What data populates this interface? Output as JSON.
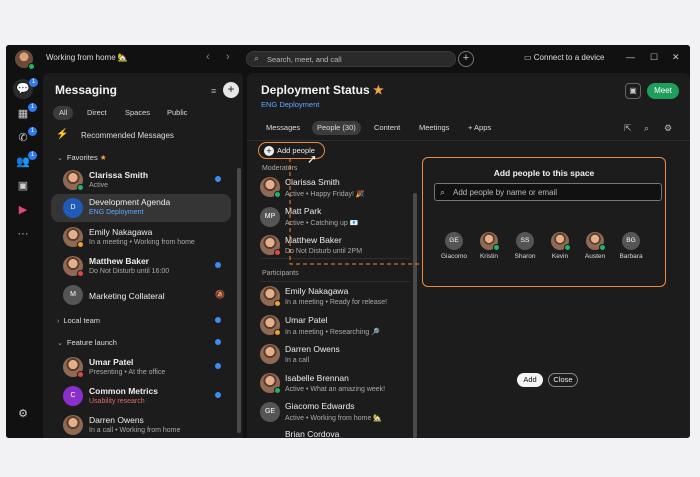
{
  "titlebar": {
    "status": "Working from home 🏡",
    "search_placeholder": "Search, meet, and call",
    "connect_label": "Connect to a device",
    "nav_back": "‹",
    "nav_forward": "›",
    "plus": "+",
    "minimize": "—",
    "maximize": "☐",
    "close": "✕"
  },
  "rail": {
    "icons": [
      "messaging-icon",
      "calendar-icon",
      "calls-icon",
      "teams-icon",
      "contacts-icon",
      "apps-icon",
      "more-icon",
      "settings-icon"
    ],
    "badges": [
      "1",
      "1",
      "1",
      "1"
    ]
  },
  "sidebar": {
    "title": "Messaging",
    "tabs": [
      "All",
      "Direct",
      "Spaces",
      "Public"
    ],
    "recommended": "Recommended Messages",
    "favorites_label": "Favorites",
    "local_team_label": "Local team",
    "feature_launch_label": "Feature launch",
    "items": [
      {
        "name": "Clarissa Smith",
        "status": "Active",
        "initials": "",
        "bold": true
      },
      {
        "name": "Development Agenda",
        "status": "ENG Deployment",
        "initials": "D",
        "bold": false
      },
      {
        "name": "Emily Nakagawa",
        "status": "In a meeting  •  Working from home",
        "initials": "",
        "bold": false
      },
      {
        "name": "Matthew Baker",
        "status": "Do Not Disturb until 16:00",
        "initials": "",
        "bold": true
      },
      {
        "name": "Marketing Collateral",
        "status": "",
        "initials": "M",
        "bold": false
      },
      {
        "name": "Umar Patel",
        "status": "Presenting  •  At the office",
        "initials": "",
        "bold": true
      },
      {
        "name": "Common Metrics",
        "status": "Usability research",
        "initials": "C",
        "bold": true
      },
      {
        "name": "Darren Owens",
        "status": "In a call  •  Working from home",
        "initials": "",
        "bold": false
      }
    ]
  },
  "space": {
    "title": "Deployment Status",
    "subtitle": "ENG Deployment",
    "meet": "Meet",
    "tabs": [
      "Messages",
      "People (30)",
      "Content",
      "Meetings",
      "+ Apps"
    ],
    "add_people": "Add people",
    "moderators_label": "Moderators",
    "participants_label": "Participants",
    "moderators": [
      {
        "name": "Clarissa Smith",
        "status": "Active  •  Happy Friday! 🎉",
        "initials": ""
      },
      {
        "name": "Matt Park",
        "status": "Active  •  Catching up 📧",
        "initials": "MP"
      },
      {
        "name": "Matthew Baker",
        "status": "Do Not Disturb until 2PM",
        "initials": ""
      }
    ],
    "participants": [
      {
        "name": "Emily Nakagawa",
        "status": "In a meeting  •  Ready for release!",
        "initials": ""
      },
      {
        "name": "Umar Patel",
        "status": "In a meeting  •  Researching 🔎",
        "initials": ""
      },
      {
        "name": "Darren Owens",
        "status": "In a call",
        "initials": ""
      },
      {
        "name": "Isabelle Brennan",
        "status": "Active  •  What an amazing week!",
        "initials": ""
      },
      {
        "name": "Giacomo Edwards",
        "status": "Active  •  Working from home 🏡",
        "initials": "GE"
      },
      {
        "name": "Brian Cordova",
        "status": "",
        "initials": ""
      }
    ]
  },
  "add_panel": {
    "title": "Add people to this space",
    "placeholder": "Add people by name or email",
    "suggestions": [
      {
        "name": "Giacomo",
        "initials": "GE"
      },
      {
        "name": "Kristin",
        "initials": ""
      },
      {
        "name": "Sharon",
        "initials": "SS"
      },
      {
        "name": "Kevin",
        "initials": ""
      },
      {
        "name": "Austen",
        "initials": ""
      },
      {
        "name": "Barbara",
        "initials": "BG"
      }
    ],
    "add_label": "Add",
    "close_label": "Close"
  },
  "colors": {
    "accent_orange": "#f08a3c",
    "link_blue": "#5fa8ff",
    "meet_green": "#1e9e5a",
    "unread_blue": "#3a8df5"
  }
}
